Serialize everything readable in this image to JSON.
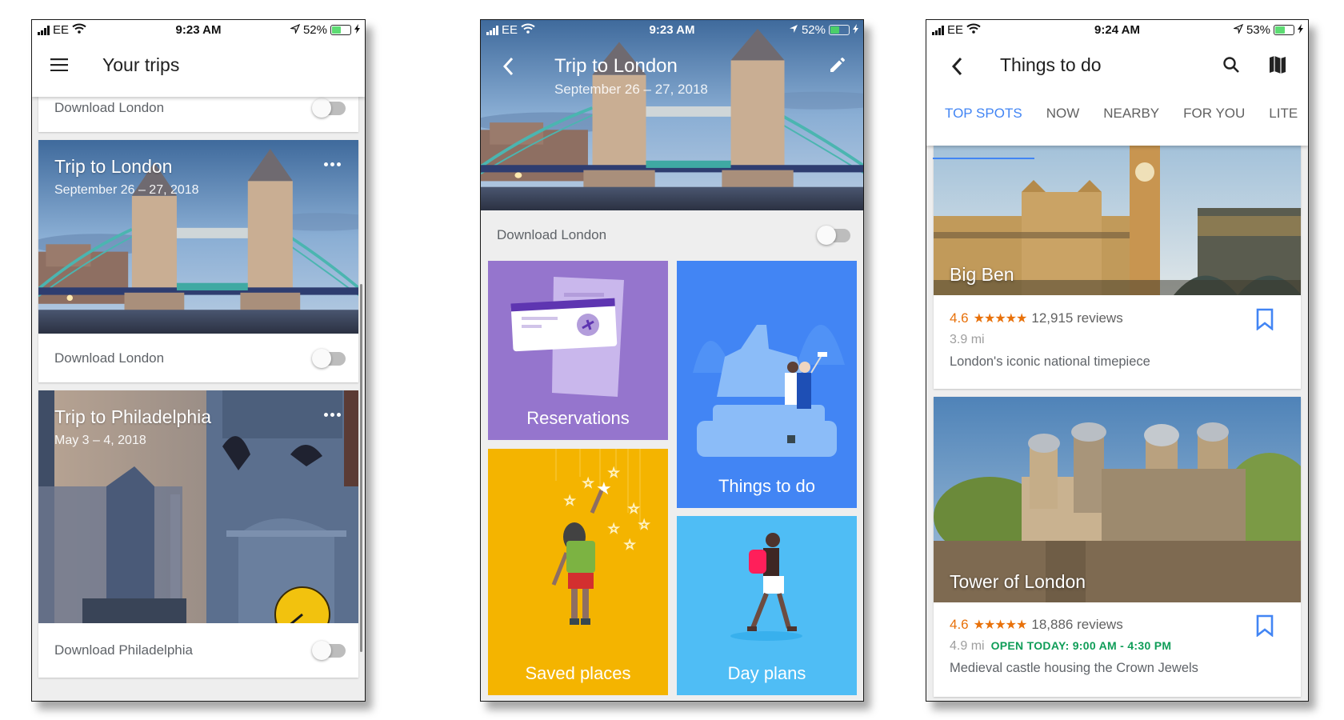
{
  "phones": [
    {
      "status": {
        "carrier": "EE",
        "time": "9:23 AM",
        "battery": "52%",
        "battery_level": 0.52
      },
      "app_bar": {
        "title": "Your trips",
        "menu_icon": "hamburger-menu-icon"
      },
      "top_card": {
        "download_label": "Download London",
        "download_enabled": false
      },
      "trips": [
        {
          "title": "Trip to London",
          "dates": "September 26 – 27, 2018",
          "download_label": "Download London",
          "download_enabled": false,
          "image": "tower-bridge-photo"
        },
        {
          "title": "Trip to Philadelphia",
          "dates": "May 3 – 4, 2018",
          "download_label": "Download Philadelphia",
          "download_enabled": false,
          "image": "philadelphia-city-hall-photo"
        }
      ]
    },
    {
      "status": {
        "carrier": "EE",
        "time": "9:23 AM",
        "battery": "52%",
        "battery_level": 0.52
      },
      "header": {
        "title": "Trip to London",
        "dates": "September 26 – 27, 2018",
        "back_icon": "back-chevron-icon",
        "edit_icon": "pencil-icon"
      },
      "download": {
        "label": "Download London",
        "enabled": false
      },
      "tiles": [
        {
          "label": "Reservations",
          "color": "#9575cd"
        },
        {
          "label": "Things to do",
          "color": "#4285f4"
        },
        {
          "label": "Saved places",
          "color": "#f4b400"
        },
        {
          "label": "Day plans",
          "color": "#4fbdf5"
        }
      ]
    },
    {
      "status": {
        "carrier": "EE",
        "time": "9:24 AM",
        "battery": "53%",
        "battery_level": 0.53
      },
      "app_bar": {
        "title": "Things to do",
        "back_icon": "back-chevron-icon",
        "search_icon": "search-icon",
        "map_icon": "map-icon"
      },
      "tabs": [
        {
          "label": "TOP SPOTS",
          "active": true
        },
        {
          "label": "NOW",
          "active": false
        },
        {
          "label": "NEARBY",
          "active": false
        },
        {
          "label": "FOR YOU",
          "active": false
        },
        {
          "label": "LITE",
          "active": false
        }
      ],
      "places": [
        {
          "name": "Big Ben",
          "rating": "4.6",
          "stars": "★★★★★",
          "reviews": "12,915 reviews",
          "distance": "3.9 mi",
          "hours": "",
          "description": "London's iconic national timepiece",
          "saved": false
        },
        {
          "name": "Tower of London",
          "rating": "4.6",
          "stars": "★★★★★",
          "reviews": "18,886 reviews",
          "distance": "4.9 mi",
          "hours": "OPEN TODAY: 9:00 AM - 4:30 PM",
          "description": "Medieval castle housing the Crown Jewels",
          "saved": false
        }
      ]
    }
  ],
  "colors": {
    "accent": "#4285f4",
    "rating": "#e8710a",
    "open": "#0f9d58"
  }
}
